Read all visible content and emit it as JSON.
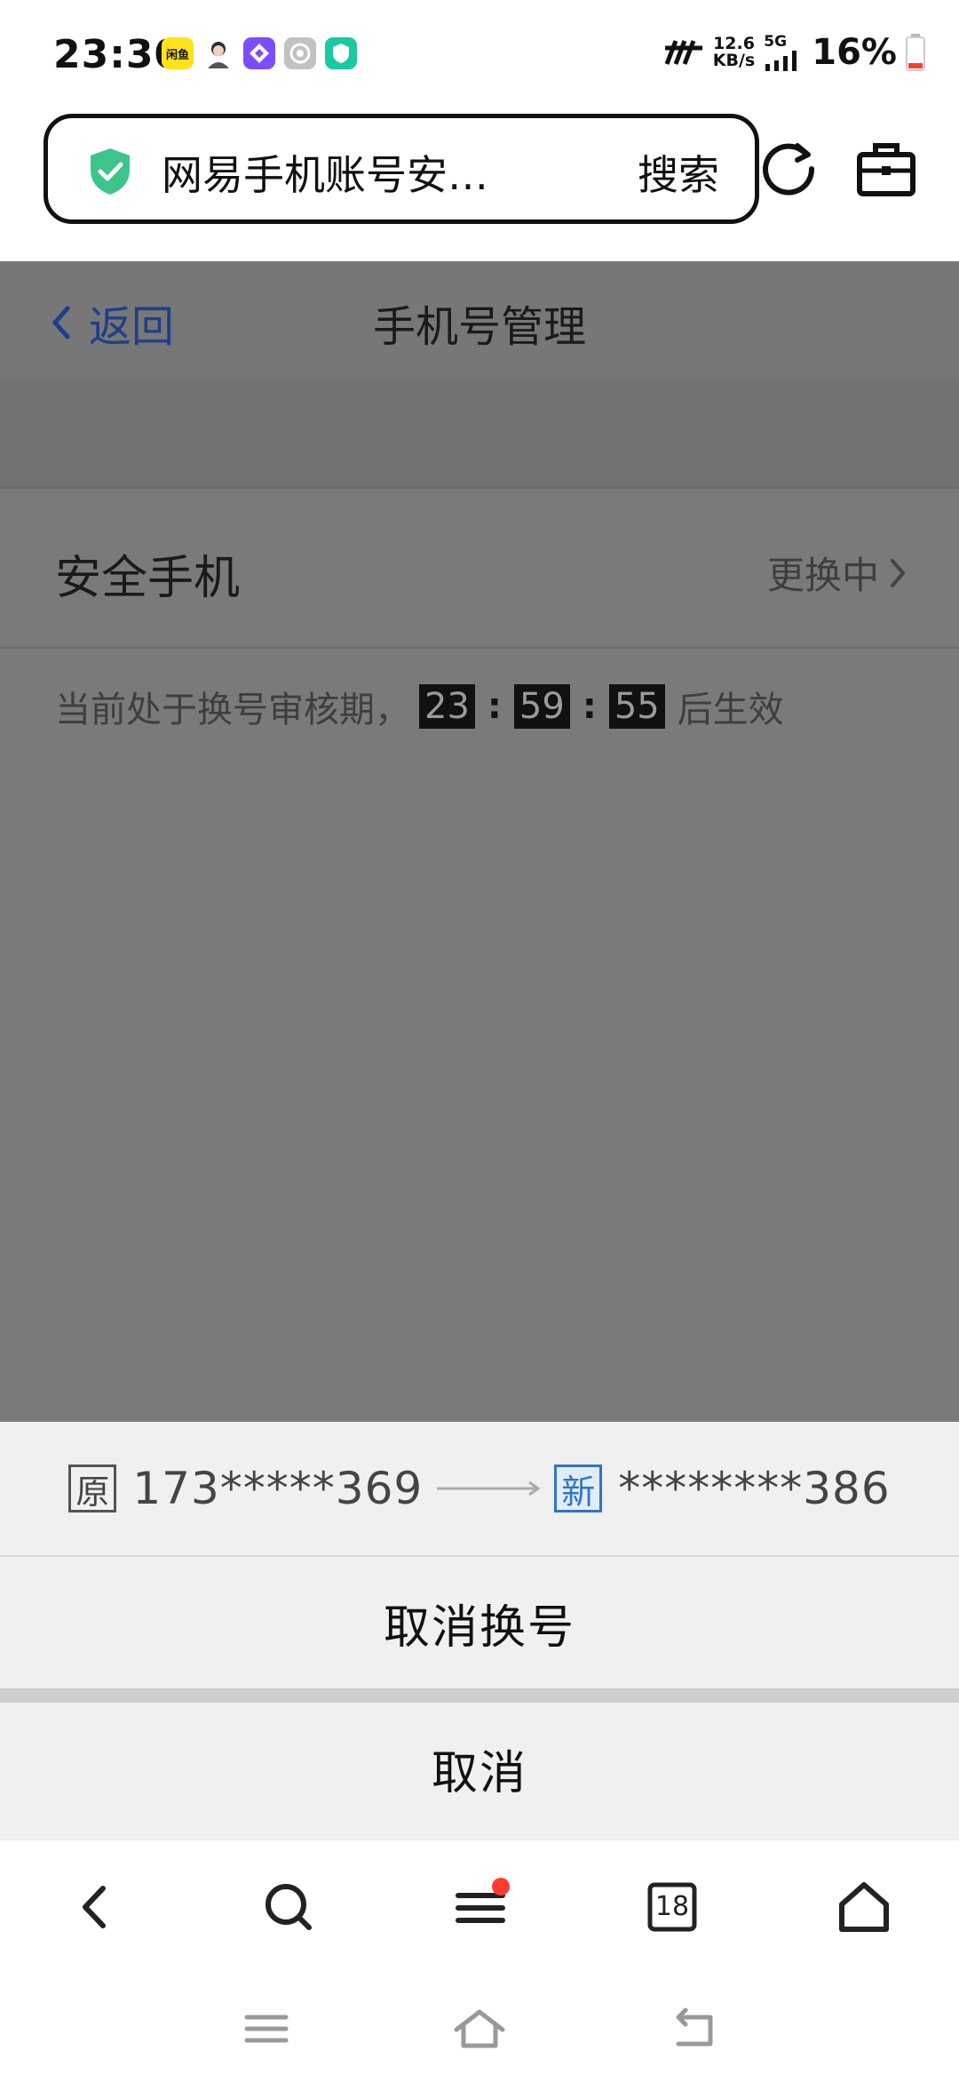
{
  "status_bar": {
    "time": "23:30",
    "apps": [
      {
        "name": "app-yellow",
        "label": "闲鱼",
        "bg": "#ffe21a",
        "fg": "#111111"
      },
      {
        "name": "app-avatar",
        "label": "",
        "bg": "#ffffff",
        "fg": "#111111"
      },
      {
        "name": "app-purple",
        "label": "",
        "bg": "#7b4dff",
        "fg": "#ffffff"
      },
      {
        "name": "app-gear",
        "label": "",
        "bg": "#bfbfbf",
        "fg": "#ffffff"
      },
      {
        "name": "app-green",
        "label": "",
        "bg": "#19c9a0",
        "fg": "#ffffff"
      }
    ],
    "speed_value": "12.6",
    "speed_unit": "KB/s",
    "network": "5G",
    "battery": "16%"
  },
  "browser": {
    "url_title": "网易手机账号安…",
    "search_label": "搜索",
    "icons": [
      "shield-check-icon",
      "refresh-icon",
      "toolbox-icon"
    ]
  },
  "page": {
    "nav": {
      "back_label": "返回",
      "title": "手机号管理"
    },
    "row": {
      "label": "安全手机",
      "value": "更换中"
    },
    "notice": {
      "prefix": "当前处于换号审核期，",
      "hours": "23",
      "minutes": "59",
      "seconds": "55",
      "suffix": "后生效"
    }
  },
  "sheet": {
    "old_tag": "原",
    "old_phone": "173*****369",
    "new_tag": "新",
    "new_phone": "********386",
    "cancel_change_label": "取消换号",
    "cancel_label": "取消"
  },
  "bottom_bar": {
    "tab_count": "18",
    "items": [
      "back-icon",
      "search-icon",
      "menu-icon",
      "tabs-icon",
      "home-icon"
    ]
  },
  "colors": {
    "dim_overlay": "#7a7a7a",
    "link_blue": "#1f3f8a",
    "accent_green": "#3cc48a",
    "new_tag_blue": "#2f73c9",
    "notification_red": "#ff3b30"
  }
}
